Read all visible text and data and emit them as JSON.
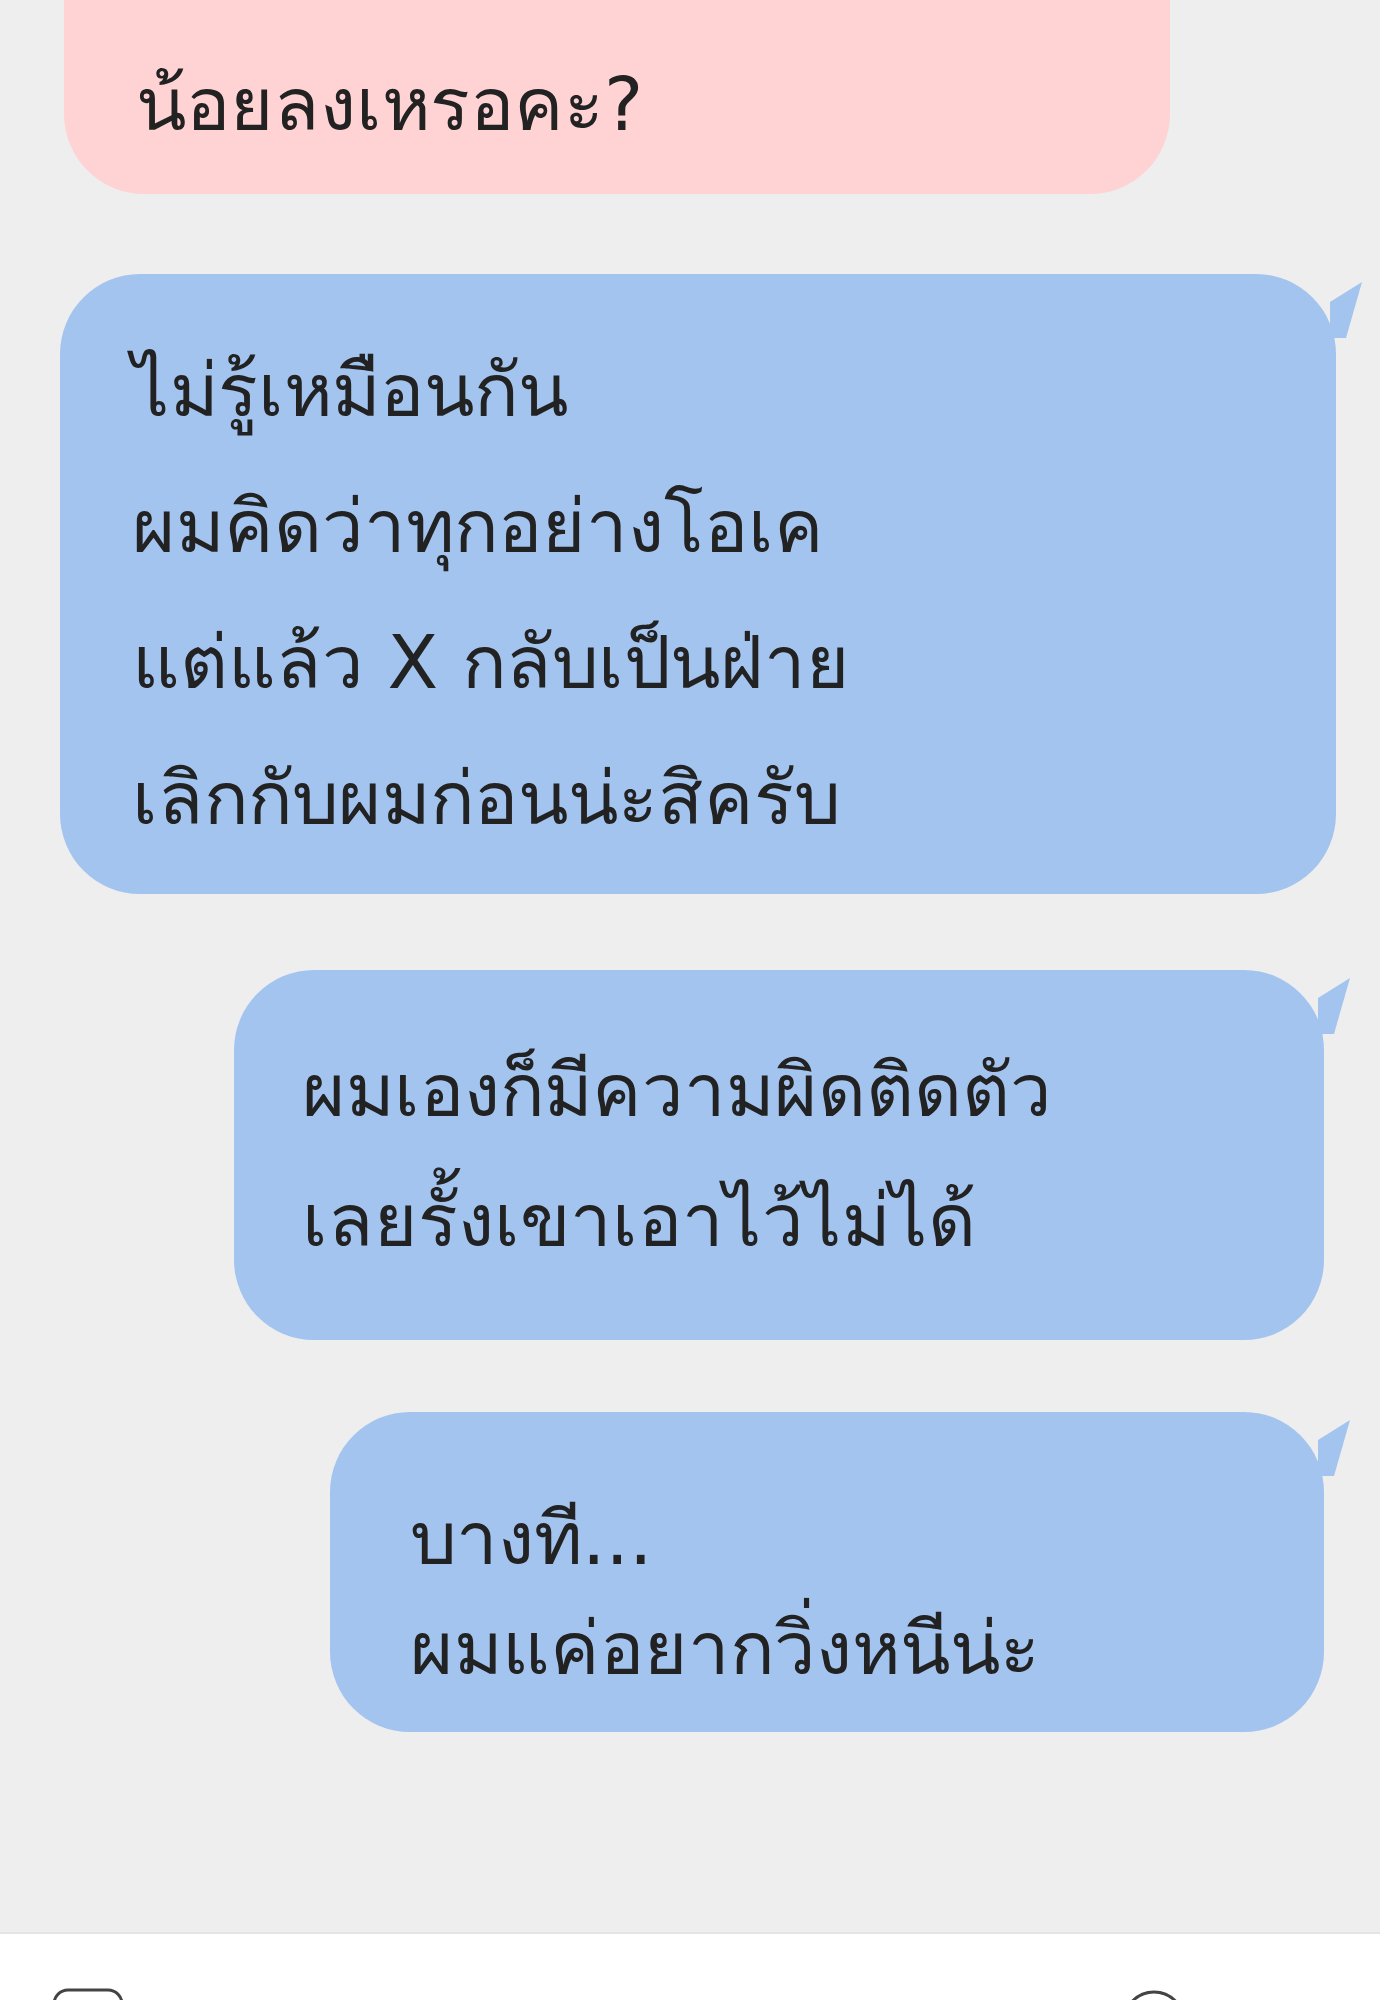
{
  "messages": [
    {
      "kind": "incoming",
      "color": "#ffd3d3",
      "lines": [
        "น้อยลงเหรอคะ?"
      ]
    },
    {
      "kind": "outgoing",
      "color": "#a3c4ef",
      "lines": [
        "ไม่รู้เหมือนกัน",
        "ผมคิดว่าทุกอย่างโอเค",
        "แต่แล้ว X กลับเป็นฝ่าย",
        "เลิกกับผมก่อนน่ะสิครับ"
      ]
    },
    {
      "kind": "outgoing",
      "color": "#a3c4ef",
      "lines": [
        "ผมเองก็มีความผิดติดตัว",
        "เลยรั้งเขาเอาไว้ไม่ได้"
      ]
    },
    {
      "kind": "outgoing",
      "color": "#a3c4ef",
      "lines": [
        "บางที...",
        "ผมแค่อยากวิ่งหนีน่ะ"
      ]
    }
  ]
}
